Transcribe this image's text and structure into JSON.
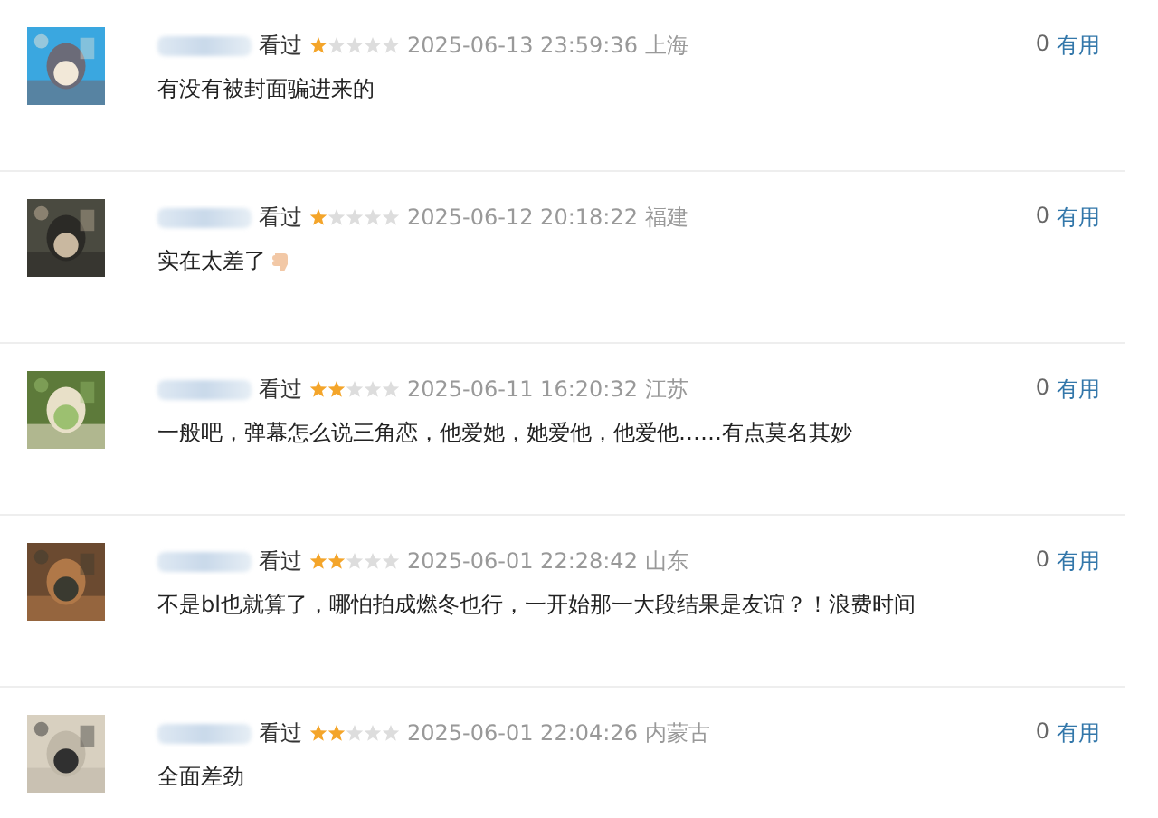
{
  "comments": [
    {
      "status": "看过",
      "stars": 1,
      "time": "2025-06-13 23:59:36",
      "location": "上海",
      "text": "有没有被封面骗进来的",
      "emoji": false,
      "votes": "0",
      "vote_label": "有用"
    },
    {
      "status": "看过",
      "stars": 1,
      "time": "2025-06-12 20:18:22",
      "location": "福建",
      "text": "实在太差了",
      "emoji": true,
      "votes": "0",
      "vote_label": "有用"
    },
    {
      "status": "看过",
      "stars": 2,
      "time": "2025-06-11 16:20:32",
      "location": "江苏",
      "text": "一般吧，弹幕怎么说三角恋，他爱她，她爱他，他爱他……有点莫名其妙",
      "emoji": false,
      "votes": "0",
      "vote_label": "有用"
    },
    {
      "status": "看过",
      "stars": 2,
      "time": "2025-06-01 22:28:42",
      "location": "山东",
      "text": "不是bl也就算了，哪怕拍成燃冬也行，一开始那一大段结果是友谊？！浪费时间",
      "emoji": false,
      "votes": "0",
      "vote_label": "有用"
    },
    {
      "status": "看过",
      "stars": 2,
      "time": "2025-06-01 22:04:26",
      "location": "内蒙古",
      "text": "全面差劲",
      "emoji": false,
      "votes": "0",
      "vote_label": "有用"
    }
  ]
}
